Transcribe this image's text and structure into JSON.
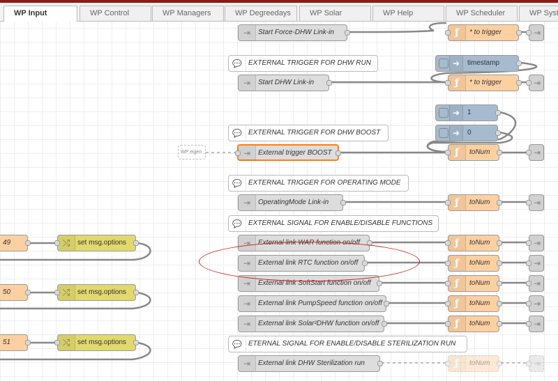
{
  "tabs": [
    "WP Input",
    "WP Control",
    "WP Managers",
    "WP Degreedays",
    "WP Solar",
    "WP Help",
    "WP Scheduler",
    "WP System"
  ],
  "colors": {
    "link_node": "#dddddd",
    "function_node": "#fdd0a2",
    "change_node": "#e2d96e",
    "inject_node": "#a6bbcf",
    "highlight": "#cc2222",
    "selected": "#ff7f0e"
  },
  "comments": {
    "c1": "EXTERNAL TRIGGER FOR DHW RUN",
    "c2": "EXTERNAL TRIGGER FOR DHW BOOST",
    "c3": "EXTERNAL TRIGGER FOR OPERATING MODE",
    "c4": "EXTERNAL SIGNAL FOR ENABLE/DISABLE FUNCTIONS",
    "c5": "ETERNAL SIGNAL FOR ENABLE/DISABLE STERILIZATION RUN"
  },
  "links": {
    "l1": "Start Force-DHW Link-in",
    "l2": "Start DHW Link-in",
    "l3": "External trigger BOOST",
    "l4": "OperatingMode Link-in",
    "l5": "External link WAR function on/off",
    "l6": "External link RTC function on/off",
    "l7": "External link SoftStart function on/off",
    "l8": "External link PumpSpeed function on/off",
    "l9": "External link Solar²DHW function on/off",
    "l10": "External link DHW Sterilization run"
  },
  "functions": {
    "f1": "* to trigger",
    "f2": "* to trigger",
    "f3": "toNum",
    "f4": "toNum",
    "f5": "toNum",
    "f6": "toNum",
    "f7": "toNum",
    "f8": "toNum",
    "f9": "toNum",
    "f10": "toNum"
  },
  "injects": {
    "i1": "timestamp",
    "i2": "1",
    "i3": "0"
  },
  "ghost_node": "WP eigen",
  "left_nodes": {
    "n1": "49",
    "n2": "50",
    "n3": "51",
    "ch1": "set msg.options",
    "ch2": "set msg.options",
    "ch3": "set msg.options"
  },
  "icons": {
    "link_in": "link-in-icon",
    "link_out": "link-out-icon",
    "function": "function-icon",
    "change": "change-shuffle-icon",
    "inject": "inject-arrow-icon",
    "comment": "speech-bubble-icon"
  }
}
